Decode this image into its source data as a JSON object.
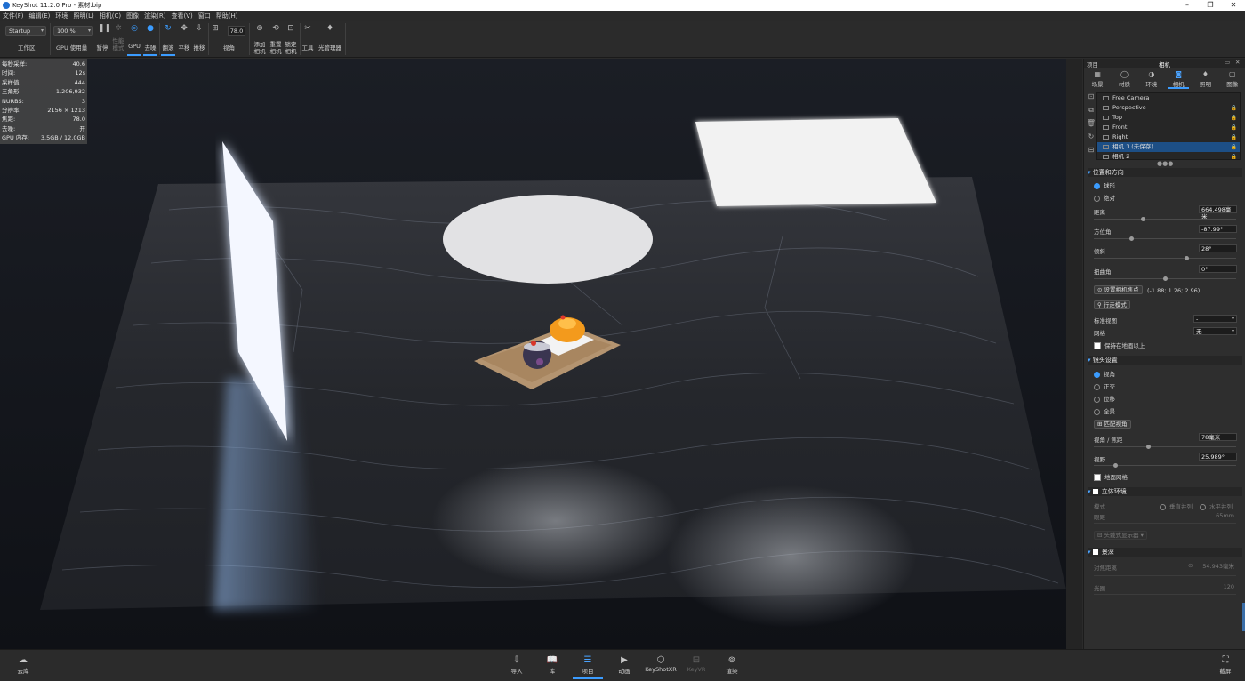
{
  "window": {
    "title": "KeyShot 11.2.0 Pro  - 素材.bip",
    "controls": [
      "–",
      "❐",
      "✕"
    ]
  },
  "menu": [
    "文件(F)",
    "编辑(E)",
    "环境",
    "照明(L)",
    "相机(C)",
    "图像",
    "渲染(R)",
    "查看(V)",
    "窗口",
    "帮助(H)"
  ],
  "toolbar": {
    "workspace_value": "Startup",
    "workspace_label": "工作区",
    "zoom_value": "100 %",
    "gpu_usage_label": "GPU 使用量",
    "pause_label": "暂停",
    "perf_mode_label_1": "性能",
    "perf_mode_label_2": "模式",
    "gpu_label": "GPU",
    "denoise_label": "去噪",
    "tumble_label": "翻滚",
    "pan_label": "平移",
    "dolly_label": "推移",
    "fov_value": "78.0",
    "fov_label": "视角",
    "add_camera_1": "添加",
    "add_camera_2": "相机",
    "reset_camera_1": "重置",
    "reset_camera_2": "相机",
    "lock_camera_1": "锁定",
    "lock_camera_2": "相机",
    "tools_label": "工具",
    "light_manager_label": "光管理器"
  },
  "stats": [
    {
      "k": "每秒采样:",
      "v": "40.6"
    },
    {
      "k": "时间:",
      "v": "12s"
    },
    {
      "k": "采样值:",
      "v": "444"
    },
    {
      "k": "三角形:",
      "v": "1,206,932"
    },
    {
      "k": "NURBS:",
      "v": "3"
    },
    {
      "k": "分辨率:",
      "v": "2156 × 1213"
    },
    {
      "k": "焦距:",
      "v": "78.0"
    },
    {
      "k": "去噪:",
      "v": "开"
    },
    {
      "k": "GPU 内存:",
      "v": "3.5GB / 12.0GB"
    }
  ],
  "panel": {
    "header_left": "项目",
    "header_title": "相机",
    "tabs": [
      {
        "label": "场景",
        "icon": "scene-icon",
        "glyph": "▦"
      },
      {
        "label": "材质",
        "icon": "material-icon",
        "glyph": "◯"
      },
      {
        "label": "环境",
        "icon": "environment-icon",
        "glyph": "◑"
      },
      {
        "label": "相机",
        "icon": "camera-icon",
        "glyph": "◙"
      },
      {
        "label": "照明",
        "icon": "lighting-icon",
        "glyph": "♦"
      },
      {
        "label": "图像",
        "icon": "image-icon",
        "glyph": "▢"
      }
    ],
    "cameras": [
      {
        "name": "Free Camera",
        "locked": false
      },
      {
        "name": "Perspective",
        "locked": true
      },
      {
        "name": "Top",
        "locked": true
      },
      {
        "name": "Front",
        "locked": true
      },
      {
        "name": "Right",
        "locked": true
      },
      {
        "name": "相机 1 (未保存)",
        "locked": true,
        "selected": true
      },
      {
        "name": "相机 2",
        "locked": true
      }
    ],
    "position": {
      "section": "位置和方向",
      "mode_spherical": "球形",
      "mode_absolute": "绝对",
      "distance_label": "距离",
      "distance_value": "664.498毫米",
      "distance_slider": 0.34,
      "azimuth_label": "方位角",
      "azimuth_value": "-87.99°",
      "azimuth_slider": 0.26,
      "incline_label": "倾斜",
      "incline_value": "28°",
      "incline_slider": 0.66,
      "twist_label": "扭曲角",
      "twist_value": "0°",
      "twist_slider": 0.5,
      "set_focus_button": "设置相机焦点",
      "focus_coords": "(-1.88; 1.26; 2.96)",
      "walk_mode_button": "行走模式",
      "std_view_label": "标准视图",
      "std_view_value": "-",
      "grid_label": "网格",
      "grid_value": "无",
      "keep_above_ground": "保持在地面以上"
    },
    "lens": {
      "section": "镜头设置",
      "opt_perspective": "视角",
      "opt_ortho": "正交",
      "opt_shift": "位移",
      "opt_panorama": "全景",
      "match_persp_button": "匹配视角",
      "fov_focal_label": "视角 / 焦距",
      "fov_focal_value": "78毫米",
      "fov_focal_slider": 0.38,
      "fov_label": "视野",
      "fov_value": "25.989°",
      "fov_slider": 0.14,
      "ground_grid": "地面网格"
    },
    "stereo": {
      "section": "立体环境",
      "mode_label": "模式",
      "mode_vertical": "垂直并列",
      "mode_horizontal": "水平并列",
      "ipd_label": "眼距",
      "ipd_value": "65mm",
      "hmd_button": "头戴式显示器"
    },
    "dof": {
      "section": "景深",
      "focus_dist_label": "对焦距离",
      "focus_dist_value": "54.943毫米",
      "aperture_label": "光圈",
      "aperture_value": "120"
    }
  },
  "bottom": {
    "cloud": "云库",
    "import": "导入",
    "library": "库",
    "project": "项目",
    "animation": "动画",
    "keyshotxr": "KeyShotXR",
    "keyvr": "KeyVR",
    "render": "渲染",
    "screenshot": "截屏"
  }
}
